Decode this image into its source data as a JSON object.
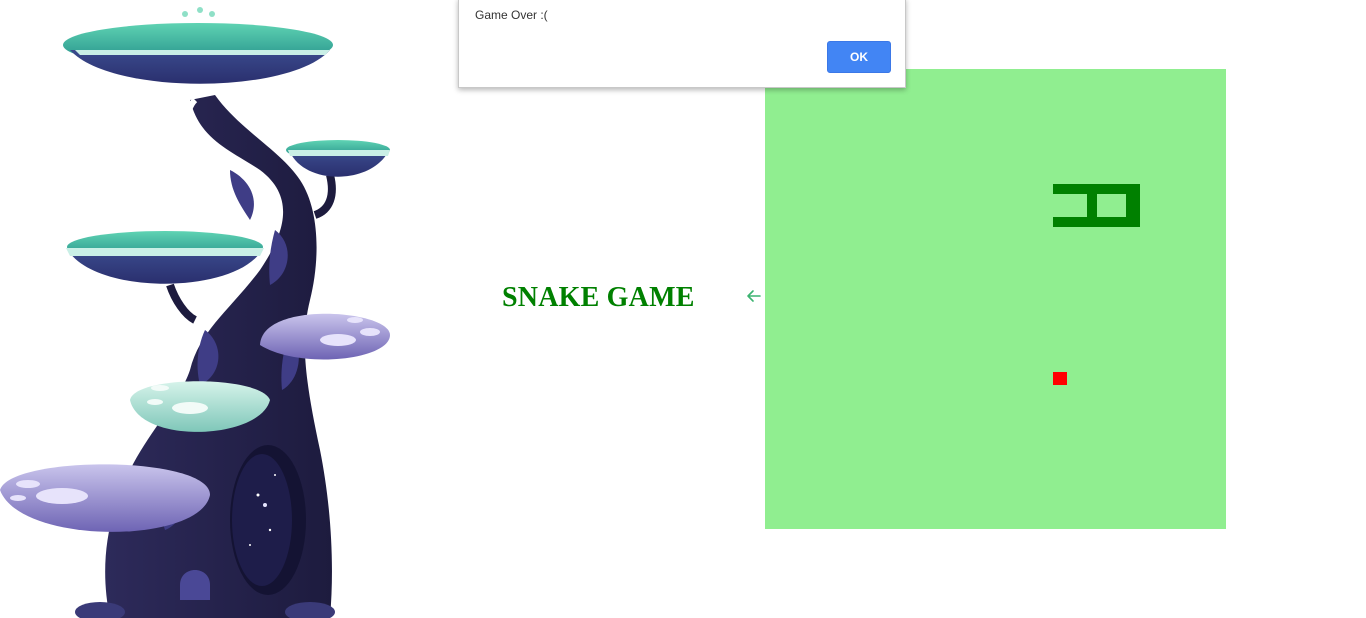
{
  "title": "SNAKE GAME",
  "alert": {
    "message": "Game Over :(",
    "ok_label": "OK"
  },
  "icons": {
    "arrow": "arrow-left-icon",
    "illustration": "fantasy-tree-illustration"
  },
  "colors": {
    "title": "#008000",
    "board": "#90ee90",
    "snake": "#008000",
    "food": "#ff0000",
    "arrow": "#3cb371",
    "ok_button": "#4285f4"
  }
}
